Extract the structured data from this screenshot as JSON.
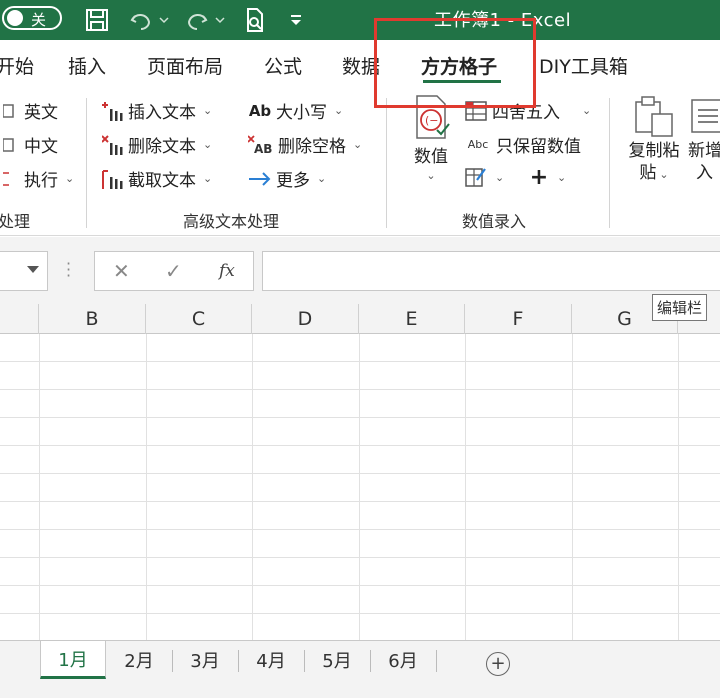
{
  "titlebar": {
    "toggle_label": "关",
    "title": "工作簿1  -  Excel"
  },
  "tabs": [
    "开始",
    "插入",
    "页面布局",
    "公式",
    "数据",
    "方方格子",
    "DIY工具箱"
  ],
  "active_tab": "方方格子",
  "ribbon": {
    "left_group": {
      "items": [
        "英文",
        "中文",
        "执行"
      ],
      "label": "处理"
    },
    "advanced_text": {
      "col1": [
        "插入文本",
        "删除文本",
        "截取文本"
      ],
      "col2": [
        "大小写",
        "删除空格",
        "更多"
      ],
      "label": "高级文本处理"
    },
    "numeric_input": {
      "big_button": "数值",
      "round_label": "四舍五入",
      "keep_numbers_label": "只保留数值",
      "label": "数值录入"
    },
    "right_group": {
      "copy_paste_line1": "复制粘",
      "copy_paste_line2": "贴",
      "new_insert_line1": "新增",
      "new_insert_line2": "入"
    }
  },
  "formula_bar": {
    "cancel_symbol": "✕",
    "confirm_symbol": "✓",
    "fx_label": "fx",
    "value": "",
    "tooltip": "编辑栏"
  },
  "grid": {
    "columns": [
      "B",
      "C",
      "D",
      "E",
      "F",
      "G"
    ]
  },
  "sheets": [
    "1月",
    "2月",
    "3月",
    "4月",
    "5月",
    "6月"
  ],
  "active_sheet": "1月",
  "colors": {
    "accent": "#217346",
    "highlight_box": "#e03a2f"
  }
}
